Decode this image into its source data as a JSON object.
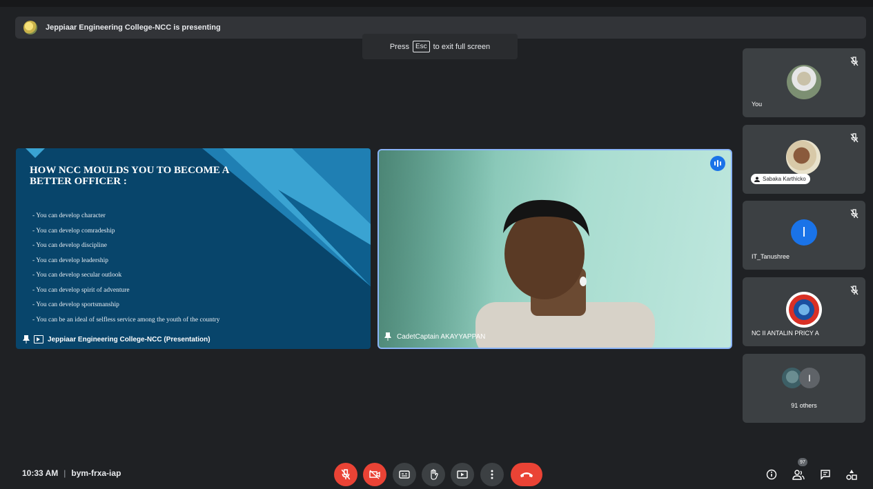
{
  "presenting_bar": {
    "text": "Jeppiaar Engineering College-NCC is presenting"
  },
  "fullscreen_toast": {
    "prefix": "Press",
    "key": "Esc",
    "suffix": "to exit full screen"
  },
  "slide": {
    "title": "HOW NCC MOULDS YOU TO BECOME A BETTER OFFICER :",
    "bullets": [
      "You can develop character",
      "You can develop comradeship",
      "You can develop discipline",
      "You can develop leadership",
      "You can develop secular outlook",
      "You can develop spirit of adventure",
      "You can develop sportsmanship",
      "You can be an ideal of selfless service among the youth of the country"
    ],
    "tile_label": "Jeppiaar Engineering College-NCC (Presentation)"
  },
  "camera_tile": {
    "name": "CadetCaptain AKAYYAPPAN"
  },
  "participants": [
    {
      "name": "You"
    },
    {
      "name": "Sabaka Karthicko"
    },
    {
      "name": "IT_Tanushree",
      "initial": "I"
    },
    {
      "name": "NC II ANTALIN PRICY A"
    },
    {
      "name": "91 others",
      "initial": "I"
    }
  ],
  "meeting": {
    "time": "10:33 AM",
    "code": "bym-frxa-iap",
    "people_count": "97"
  },
  "colors": {
    "background": "#1f2124",
    "danger": "#ea4335",
    "accent": "#1a73e8",
    "tile": "#3c4043"
  }
}
